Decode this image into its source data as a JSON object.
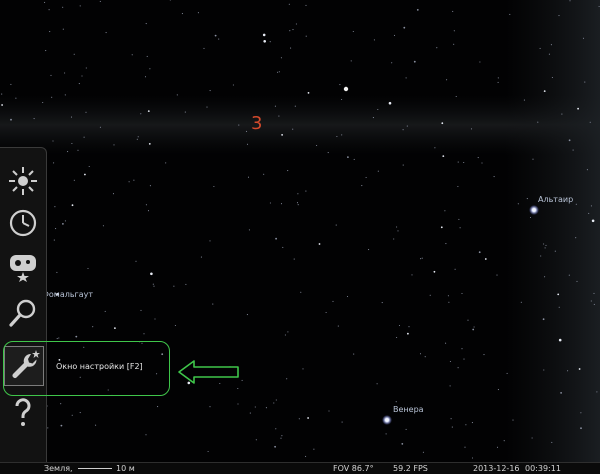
{
  "overlay": {
    "step_number": "3"
  },
  "sky_labels": {
    "altair": "Альтаир",
    "fomalhaut": "Фомальгаут",
    "venus": "Венера"
  },
  "sidebar": {
    "items": [
      {
        "icon": "sky-culture-sun-icon",
        "active": false
      },
      {
        "icon": "clock-icon",
        "active": false
      },
      {
        "icon": "sky-and-viewing-options-icon",
        "active": false
      },
      {
        "icon": "search-magnifier-icon",
        "active": false
      },
      {
        "icon": "wrench-settings-icon",
        "active": true
      },
      {
        "icon": "help-question-icon",
        "active": false
      }
    ]
  },
  "tooltip": {
    "text": "Окно настройки  [F2]"
  },
  "statusbar": {
    "location": "Земля,",
    "altitude": "10 м",
    "fov": "FOV 86.7°",
    "fps": "59.2 FPS",
    "date": "2013-12-16",
    "time": "00:39:11"
  },
  "colors": {
    "callout": "#3fc64a",
    "step_number": "#d44a2c",
    "star_label": "#b8c3d6"
  }
}
